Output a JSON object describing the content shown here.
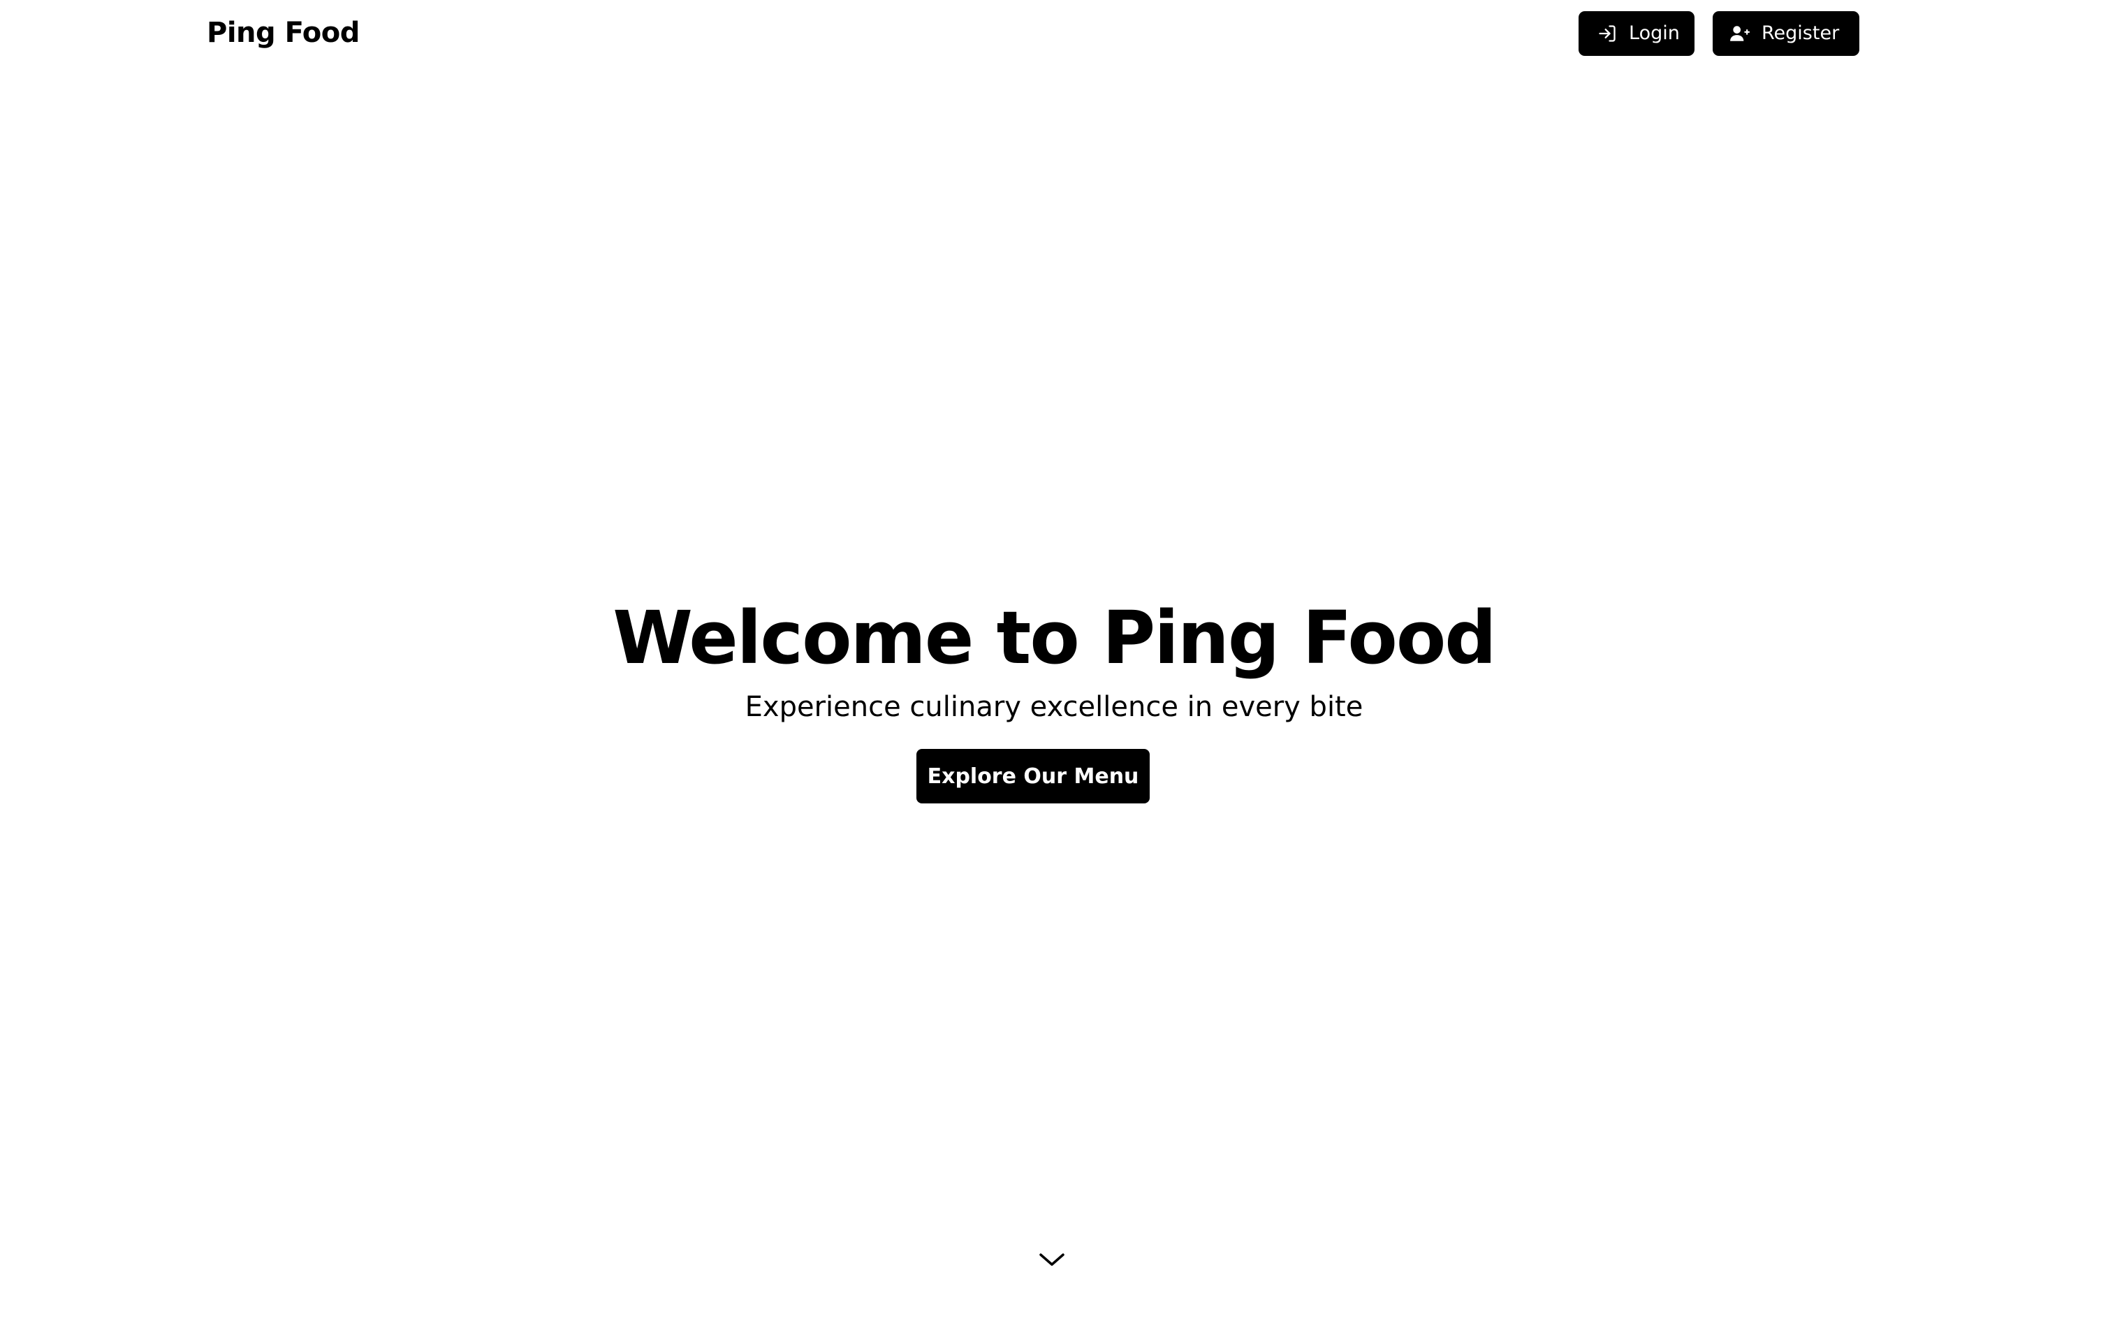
{
  "header": {
    "brand": "Ping Food",
    "login_label": "Login",
    "register_label": "Register",
    "login_icon": "login-icon",
    "register_icon": "user-plus-icon"
  },
  "hero": {
    "title": "Welcome to Ping Food",
    "subtitle": "Experience culinary excellence in every bite",
    "cta_label": "Explore Our Menu",
    "scroll_icon": "chevron-down-icon"
  },
  "colors": {
    "background": "#ffffff",
    "button_bg": "#000000",
    "button_text": "#ffffff",
    "text": "#000000"
  }
}
